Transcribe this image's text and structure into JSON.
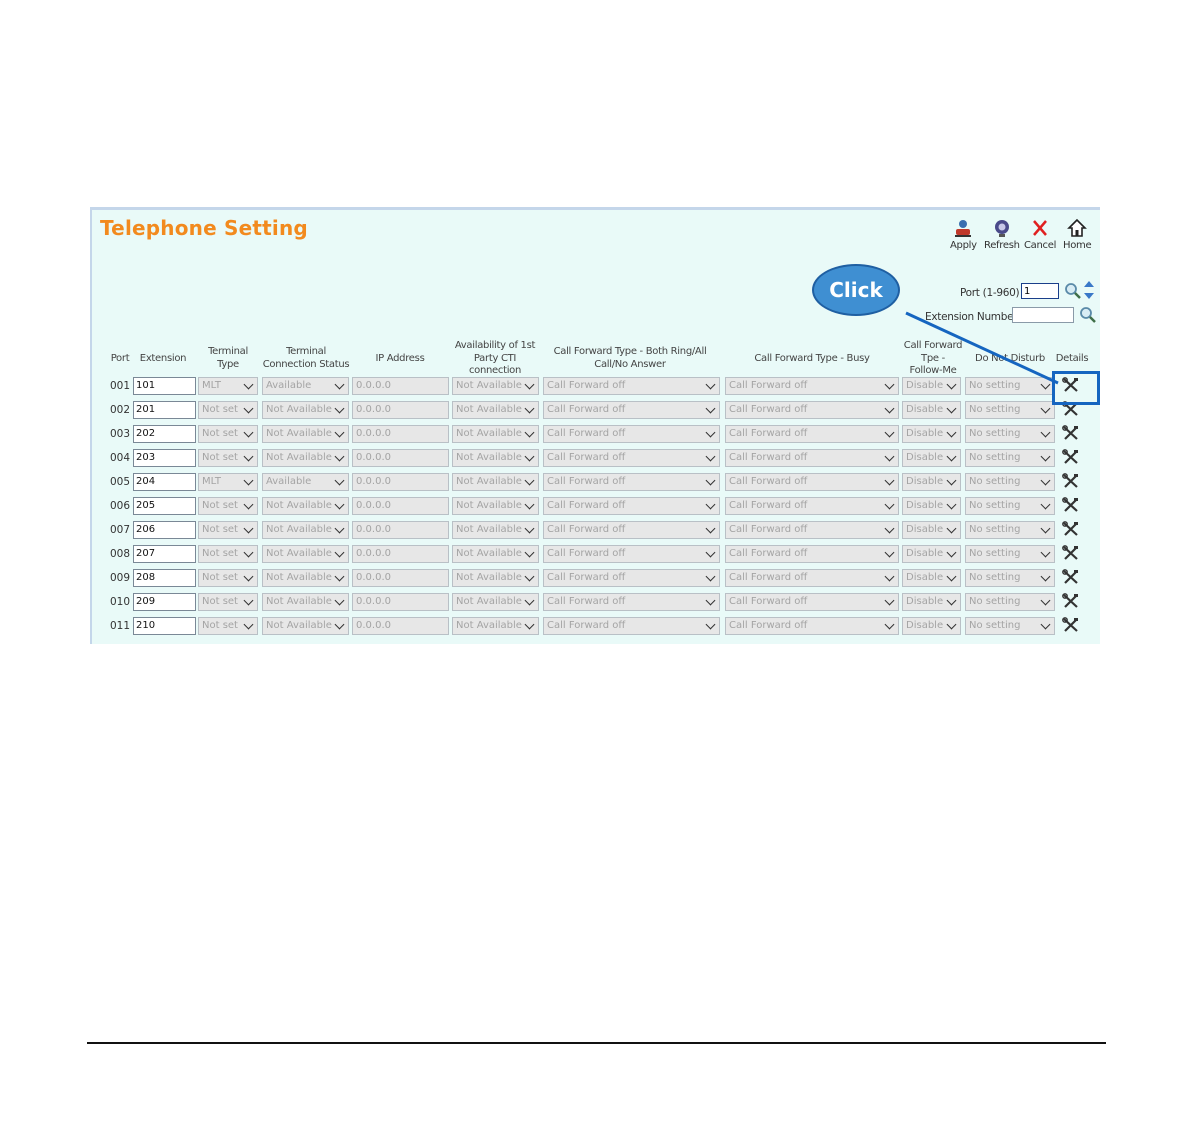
{
  "page": {
    "title": "Telephone Setting"
  },
  "toolbar": {
    "apply": "Apply",
    "refresh": "Refresh",
    "cancel": "Cancel",
    "home": "Home"
  },
  "search": {
    "port_label": "Port (1-960)",
    "port_value": "1",
    "extension_label": "Extension Number",
    "extension_value": ""
  },
  "headers": {
    "port": "Port",
    "extension": "Extension",
    "terminal_type": [
      "Terminal",
      "Type"
    ],
    "connection_status": [
      "Terminal",
      "Connection Status"
    ],
    "ip_address": "IP Address",
    "cti": [
      "Availability of 1st",
      "Party CTI",
      "connection"
    ],
    "cf_both": [
      "Call Forward Type - Both Ring/All",
      "Call/No Answer"
    ],
    "cf_busy": "Call Forward Type - Busy",
    "cf_follow": [
      "Call Forward",
      "Tpe -",
      "Follow-Me"
    ],
    "dnd": "Do Not Disturb",
    "details": "Details"
  },
  "annotation": {
    "callout": "Click"
  },
  "rows": [
    {
      "port": "001",
      "extension": "101",
      "terminal_type": "MLT",
      "status": "Available",
      "ip": "0.0.0.0",
      "cti": "Not Available",
      "cf_both": "Call Forward off",
      "cf_busy": "Call Forward off",
      "cf_follow": "Disable",
      "dnd": "No setting"
    },
    {
      "port": "002",
      "extension": "201",
      "terminal_type": "Not set",
      "status": "Not Available",
      "ip": "0.0.0.0",
      "cti": "Not Available",
      "cf_both": "Call Forward off",
      "cf_busy": "Call Forward off",
      "cf_follow": "Disable",
      "dnd": "No setting"
    },
    {
      "port": "003",
      "extension": "202",
      "terminal_type": "Not set",
      "status": "Not Available",
      "ip": "0.0.0.0",
      "cti": "Not Available",
      "cf_both": "Call Forward off",
      "cf_busy": "Call Forward off",
      "cf_follow": "Disable",
      "dnd": "No setting"
    },
    {
      "port": "004",
      "extension": "203",
      "terminal_type": "Not set",
      "status": "Not Available",
      "ip": "0.0.0.0",
      "cti": "Not Available",
      "cf_both": "Call Forward off",
      "cf_busy": "Call Forward off",
      "cf_follow": "Disable",
      "dnd": "No setting"
    },
    {
      "port": "005",
      "extension": "204",
      "terminal_type": "MLT",
      "status": "Available",
      "ip": "0.0.0.0",
      "cti": "Not Available",
      "cf_both": "Call Forward off",
      "cf_busy": "Call Forward off",
      "cf_follow": "Disable",
      "dnd": "No setting"
    },
    {
      "port": "006",
      "extension": "205",
      "terminal_type": "Not set",
      "status": "Not Available",
      "ip": "0.0.0.0",
      "cti": "Not Available",
      "cf_both": "Call Forward off",
      "cf_busy": "Call Forward off",
      "cf_follow": "Disable",
      "dnd": "No setting"
    },
    {
      "port": "007",
      "extension": "206",
      "terminal_type": "Not set",
      "status": "Not Available",
      "ip": "0.0.0.0",
      "cti": "Not Available",
      "cf_both": "Call Forward off",
      "cf_busy": "Call Forward off",
      "cf_follow": "Disable",
      "dnd": "No setting"
    },
    {
      "port": "008",
      "extension": "207",
      "terminal_type": "Not set",
      "status": "Not Available",
      "ip": "0.0.0.0",
      "cti": "Not Available",
      "cf_both": "Call Forward off",
      "cf_busy": "Call Forward off",
      "cf_follow": "Disable",
      "dnd": "No setting"
    },
    {
      "port": "009",
      "extension": "208",
      "terminal_type": "Not set",
      "status": "Not Available",
      "ip": "0.0.0.0",
      "cti": "Not Available",
      "cf_both": "Call Forward off",
      "cf_busy": "Call Forward off",
      "cf_follow": "Disable",
      "dnd": "No setting"
    },
    {
      "port": "010",
      "extension": "209",
      "terminal_type": "Not set",
      "status": "Not Available",
      "ip": "0.0.0.0",
      "cti": "Not Available",
      "cf_both": "Call Forward off",
      "cf_busy": "Call Forward off",
      "cf_follow": "Disable",
      "dnd": "No setting"
    },
    {
      "port": "011",
      "extension": "210",
      "terminal_type": "Not set",
      "status": "Not Available",
      "ip": "0.0.0.0",
      "cti": "Not Available",
      "cf_both": "Call Forward off",
      "cf_busy": "Call Forward off",
      "cf_follow": "Disable",
      "dnd": "No setting"
    }
  ],
  "icons": {
    "apply": "user-apply-icon",
    "refresh": "refresh-icon",
    "cancel": "close-icon",
    "home": "home-icon",
    "search": "search-icon",
    "sort": "sort-arrows-icon",
    "details": "tools-icon"
  },
  "colors": {
    "title": "#f28a1e",
    "panel_bg": "#e9faf8",
    "callout": "#3f8fd2",
    "highlight": "#1565c0"
  }
}
